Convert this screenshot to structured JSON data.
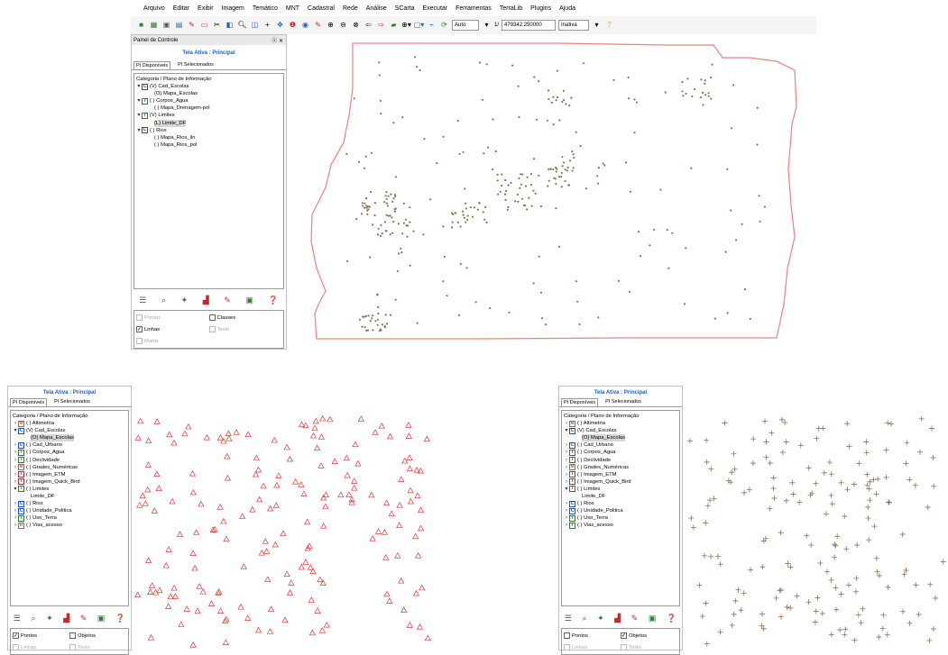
{
  "menu": [
    "Arquivo",
    "Editar",
    "Exibir",
    "Imagem",
    "Temático",
    "MNT",
    "Cadastral",
    "Rede",
    "Análise",
    "SCarta",
    "Executar",
    "Ferramentas",
    "TerraLib",
    "Plugins",
    "Ajuda"
  ],
  "toolbar": {
    "scale_mode": "Auto",
    "scale_prefix": "1/",
    "scale_value": "479342.250000",
    "status_select": "Inativa"
  },
  "top_panel": {
    "title": "Painel de Controle",
    "close": "ⓧ ✕",
    "active": "Tela Ativa : Principal",
    "tabs": [
      "PI Disponíveis",
      "PI Selecionados"
    ],
    "tree_header": "Categoria / Plano de Informação",
    "tree": [
      {
        "chev": "▾",
        "badge": "C",
        "color": "b-blue",
        "label": "(V) Cad_Escolas",
        "indent": 0
      },
      {
        "chev": "",
        "badge": "",
        "label": "(O) Mapa_Escolas",
        "indent": 1
      },
      {
        "chev": "▾",
        "badge": "T",
        "color": "b-green",
        "label": "( ) Corpos_Agua",
        "indent": 0
      },
      {
        "chev": "",
        "badge": "",
        "label": "( ) Mapa_Drenagem-pol",
        "indent": 1
      },
      {
        "chev": "▾",
        "badge": "T",
        "color": "b-green",
        "label": "(V) Limites",
        "indent": 0
      },
      {
        "chev": "",
        "badge": "",
        "label": "(L) Limite_DF",
        "indent": 1,
        "hl": true
      },
      {
        "chev": "▾",
        "badge": "C",
        "color": "b-blue",
        "label": "( ) Rios",
        "indent": 0
      },
      {
        "chev": "",
        "badge": "",
        "label": "( ) Mapa_Rios_lin",
        "indent": 1
      },
      {
        "chev": "",
        "badge": "",
        "label": "( ) Mapa_Rios_pol",
        "indent": 1
      }
    ],
    "checks": [
      {
        "label": "Pontos",
        "checked": false,
        "disabled": true
      },
      {
        "label": "Classes",
        "checked": false,
        "disabled": false
      },
      {
        "label": "Linhas",
        "checked": true,
        "disabled": false
      },
      {
        "label": "Texto",
        "checked": false,
        "disabled": true
      },
      {
        "label": "Matriz",
        "checked": false,
        "disabled": true
      }
    ]
  },
  "left_panel": {
    "active": "Tela Ativa : Principal",
    "tabs": [
      "PI Disponíveis",
      "PI Selecionados"
    ],
    "tree_header": "Categoria / Plano de Informação",
    "tree": [
      {
        "chev": "›",
        "badge": "M",
        "color": "b-brown",
        "label": "( ) Altimetria",
        "indent": 0
      },
      {
        "chev": "▾",
        "badge": "C",
        "color": "b-blue",
        "label": "(V) Cad_Escolas",
        "indent": 0
      },
      {
        "chev": "",
        "badge": "",
        "label": "(O) Mapa_Escolas",
        "indent": 1,
        "hl": true
      },
      {
        "chev": "›",
        "badge": "C",
        "color": "b-blue",
        "label": "( ) Cad_Urbano",
        "indent": 0
      },
      {
        "chev": "›",
        "badge": "T",
        "color": "b-green",
        "label": "( ) Corpos_Agua",
        "indent": 0
      },
      {
        "chev": "›",
        "badge": "T",
        "color": "b-green",
        "label": "( ) Declividade",
        "indent": 0
      },
      {
        "chev": "›",
        "badge": "M",
        "color": "b-brown",
        "label": "( ) Grades_Numéricas",
        "indent": 0
      },
      {
        "chev": "›",
        "badge": "I",
        "color": "b-red",
        "label": "( ) Imagem_ETM",
        "indent": 0
      },
      {
        "chev": "›",
        "badge": "I",
        "color": "b-red",
        "label": "( ) Imagem_Quick_Bird",
        "indent": 0
      },
      {
        "chev": "▾",
        "badge": "T",
        "color": "b-green",
        "label": "( ) Limites",
        "indent": 0
      },
      {
        "chev": "",
        "badge": "",
        "label": "Limite_DF",
        "indent": 1
      },
      {
        "chev": "›",
        "badge": "C",
        "color": "b-blue",
        "label": "( ) Rios",
        "indent": 0
      },
      {
        "chev": "›",
        "badge": "C",
        "color": "b-blue",
        "label": "( ) Unidade_Politica",
        "indent": 0
      },
      {
        "chev": "›",
        "badge": "T",
        "color": "b-green",
        "label": "( ) Uso_Terra",
        "indent": 0
      },
      {
        "chev": "›",
        "badge": "R",
        "color": "b-gray",
        "label": "( ) Vias_acesso",
        "indent": 0
      }
    ],
    "checks": [
      {
        "label": "Pontos",
        "checked": true,
        "disabled": false
      },
      {
        "label": "Objetos",
        "checked": false,
        "disabled": false
      },
      {
        "label": "Linhas",
        "checked": false,
        "disabled": true
      },
      {
        "label": "Texto",
        "checked": false,
        "disabled": true
      }
    ]
  },
  "right_panel": {
    "active": "Tela Ativa : Principal",
    "tabs": [
      "PI Disponíveis",
      "PI Selecionados"
    ],
    "tree_header": "Categoria / Plano de Informação",
    "tree": [
      {
        "chev": "›",
        "badge": "M",
        "color": "b-brown",
        "label": "( ) Altimetria",
        "indent": 0
      },
      {
        "chev": "▾",
        "badge": "C",
        "color": "b-blue",
        "label": "(V) Cad_Escolas",
        "indent": 0
      },
      {
        "chev": "",
        "badge": "",
        "label": "(O) Mapa_Escolas",
        "indent": 1,
        "hl": true
      },
      {
        "chev": "›",
        "badge": "C",
        "color": "b-blue",
        "label": "( ) Cad_Urbano",
        "indent": 0
      },
      {
        "chev": "›",
        "badge": "T",
        "color": "b-green",
        "label": "( ) Corpos_Agua",
        "indent": 0
      },
      {
        "chev": "›",
        "badge": "T",
        "color": "b-green",
        "label": "( ) Declividade",
        "indent": 0
      },
      {
        "chev": "›",
        "badge": "M",
        "color": "b-brown",
        "label": "( ) Grades_Numéricas",
        "indent": 0
      },
      {
        "chev": "›",
        "badge": "I",
        "color": "b-red",
        "label": "( ) Imagem_ETM",
        "indent": 0
      },
      {
        "chev": "›",
        "badge": "I",
        "color": "b-red",
        "label": "( ) Imagem_Quick_Bird",
        "indent": 0
      },
      {
        "chev": "▾",
        "badge": "T",
        "color": "b-green",
        "label": "( ) Limites",
        "indent": 0
      },
      {
        "chev": "",
        "badge": "",
        "label": "Limite_DF",
        "indent": 1
      },
      {
        "chev": "›",
        "badge": "C",
        "color": "b-blue",
        "label": "( ) Rios",
        "indent": 0
      },
      {
        "chev": "›",
        "badge": "C",
        "color": "b-blue",
        "label": "( ) Unidade_Politica",
        "indent": 0
      },
      {
        "chev": "›",
        "badge": "T",
        "color": "b-green",
        "label": "( ) Uso_Terra",
        "indent": 0
      },
      {
        "chev": "›",
        "badge": "T",
        "color": "b-green",
        "label": "( ) Vias_acesso",
        "indent": 0
      }
    ],
    "checks": [
      {
        "label": "Pontos",
        "checked": false,
        "disabled": false
      },
      {
        "label": "Objetos",
        "checked": true,
        "disabled": false
      },
      {
        "label": "Linhas",
        "checked": false,
        "disabled": true
      },
      {
        "label": "Texto",
        "checked": false,
        "disabled": true
      }
    ]
  },
  "colors": {
    "boundary": "#f08080",
    "school_points": "#8b7355",
    "triangles": "#e53935",
    "crosses": "#8b7355",
    "accent": "#1f5fbf"
  },
  "panel_tool_icons": [
    "list-icon",
    "zoom-icon",
    "legend-icon",
    "chart-icon",
    "pencil-icon",
    "grid-icon",
    "help-icon"
  ]
}
